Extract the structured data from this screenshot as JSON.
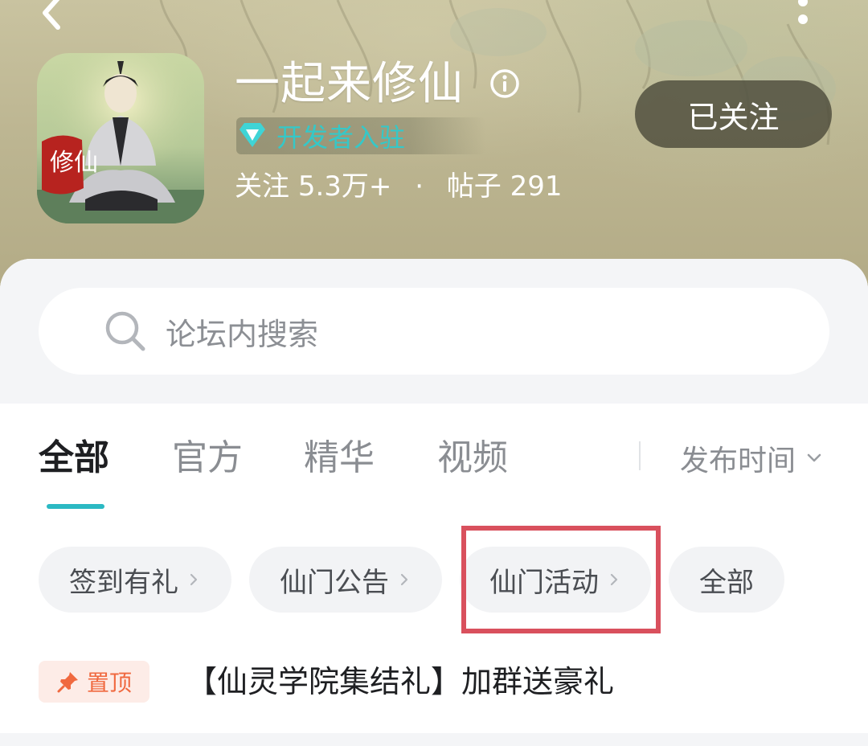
{
  "header": {
    "back_icon": "chevron-left-icon",
    "more_icon": "more-vertical-icon",
    "app": {
      "icon_text": "修仙",
      "title": "一起来修仙",
      "info_icon": "info-icon",
      "dev_badge": "开发者入驻",
      "stats": {
        "follow_label": "关注",
        "follow_count": "5.3万+",
        "separator": "·",
        "posts_label": "帖子",
        "posts_count": "291"
      }
    },
    "follow_button": "已关注"
  },
  "search": {
    "placeholder": "论坛内搜索"
  },
  "tabs": [
    {
      "label": "全部",
      "active": true
    },
    {
      "label": "官方",
      "active": false
    },
    {
      "label": "精华",
      "active": false
    },
    {
      "label": "视频",
      "active": false
    }
  ],
  "sort": {
    "label": "发布时间"
  },
  "chips": [
    {
      "label": "签到有礼",
      "has_arrow": true
    },
    {
      "label": "仙门公告",
      "has_arrow": true
    },
    {
      "label": "仙门活动",
      "has_arrow": true,
      "highlighted": true
    },
    {
      "label": "全部",
      "has_arrow": false
    }
  ],
  "pinned_post": {
    "badge": "置顶",
    "title": "【仙灵学院集结礼】加群送豪礼"
  },
  "colors": {
    "accent": "#2bb9c3",
    "highlight": "#d9505d",
    "pin": "#f0693f",
    "dev_badge_text": "#35c8c8"
  }
}
